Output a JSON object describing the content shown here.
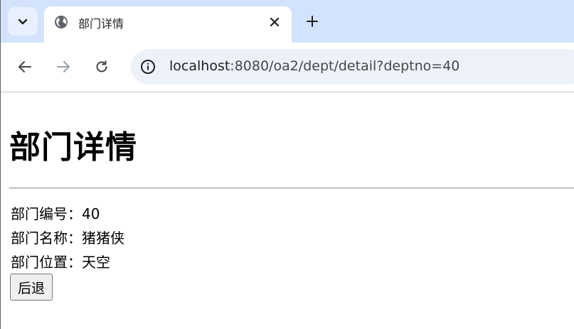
{
  "browser": {
    "tab": {
      "title": "部门详情"
    },
    "address": {
      "host": "localhost",
      "rest": ":8080/oa2/dept/detail?deptno=40"
    }
  },
  "page": {
    "title": "部门详情",
    "fields": [
      {
        "label": "部门编号",
        "sep": "：",
        "value": "40"
      },
      {
        "label": "部门名称",
        "sep": "：",
        "value": "猪猪侠"
      },
      {
        "label": "部门位置",
        "sep": "：",
        "value": "天空"
      }
    ],
    "back_label": "后退"
  }
}
